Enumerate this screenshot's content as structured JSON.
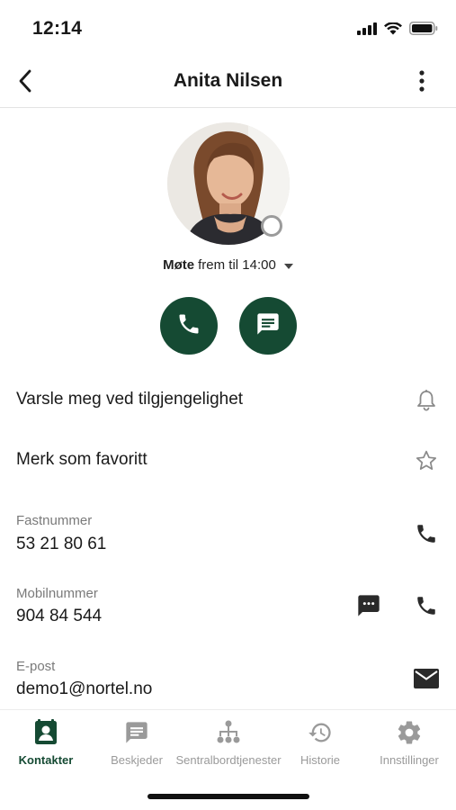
{
  "status_bar": {
    "time": "12:14"
  },
  "nav": {
    "title": "Anita Nilsen"
  },
  "contact": {
    "status_strong": "Møte",
    "status_rest": "frem til 14:00"
  },
  "options": {
    "notify_label": "Varsle meg ved tilgjengelighet",
    "favorite_label": "Merk som favoritt"
  },
  "fields": {
    "landline_label": "Fastnummer",
    "landline_value": "53 21 80 61",
    "mobile_label": "Mobilnummer",
    "mobile_value": "904 84 544",
    "email_label": "E-post",
    "email_value": "demo1@nortel.no"
  },
  "tabs": [
    {
      "label": "Kontakter",
      "icon": "contacts-icon",
      "active": true
    },
    {
      "label": "Beskjeder",
      "icon": "message-icon",
      "active": false
    },
    {
      "label": "Sentralbordtjenester",
      "icon": "org-chart-icon",
      "active": false
    },
    {
      "label": "Historie",
      "icon": "history-icon",
      "active": false
    },
    {
      "label": "Innstillinger",
      "icon": "gear-icon",
      "active": false
    }
  ],
  "colors": {
    "brand": "#154a33",
    "muted": "#9a9a9a",
    "presence": "#9b9b9b"
  }
}
